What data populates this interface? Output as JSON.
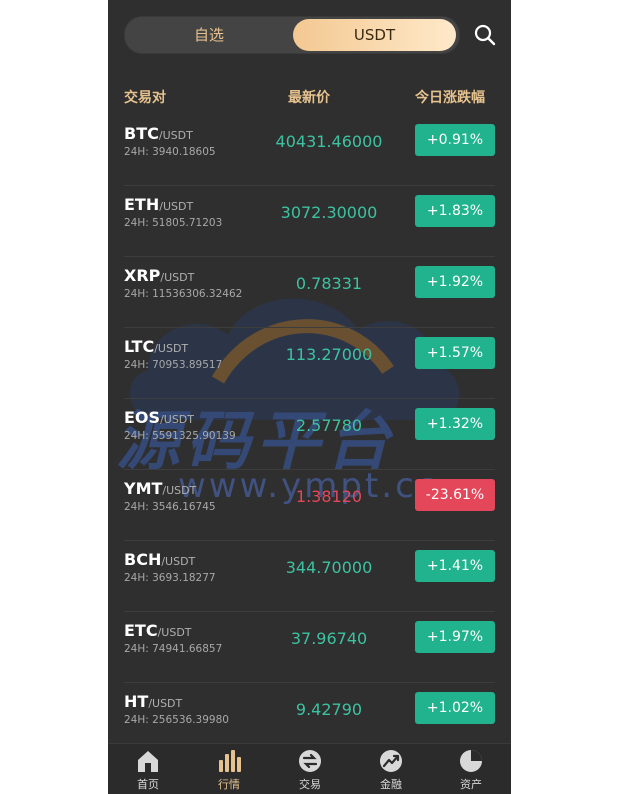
{
  "tabs": {
    "watchlist": "自选",
    "usdt": "USDT"
  },
  "table_header": {
    "pair": "交易对",
    "price": "最新价",
    "change": "今日涨跌幅"
  },
  "rows": [
    {
      "base": "BTC",
      "quote": "/USDT",
      "volume": "24H: 3940.18605",
      "price": "40431.46000",
      "change": "+0.91%",
      "direction": "up"
    },
    {
      "base": "ETH",
      "quote": "/USDT",
      "volume": "24H: 51805.71203",
      "price": "3072.30000",
      "change": "+1.83%",
      "direction": "up"
    },
    {
      "base": "XRP",
      "quote": "/USDT",
      "volume": "24H: 11536306.32462",
      "price": "0.78331",
      "change": "+1.92%",
      "direction": "up"
    },
    {
      "base": "LTC",
      "quote": "/USDT",
      "volume": "24H: 70953.89517",
      "price": "113.27000",
      "change": "+1.57%",
      "direction": "up"
    },
    {
      "base": "EOS",
      "quote": "/USDT",
      "volume": "24H: 5591325.90139",
      "price": "2.57780",
      "change": "+1.32%",
      "direction": "up"
    },
    {
      "base": "YMT",
      "quote": "/USDT",
      "volume": "24H: 3546.16745",
      "price": "1.38120",
      "change": "-23.61%",
      "direction": "down"
    },
    {
      "base": "BCH",
      "quote": "/USDT",
      "volume": "24H: 3693.18277",
      "price": "344.70000",
      "change": "+1.41%",
      "direction": "up"
    },
    {
      "base": "ETC",
      "quote": "/USDT",
      "volume": "24H: 74941.66857",
      "price": "37.96740",
      "change": "+1.97%",
      "direction": "up"
    },
    {
      "base": "HT",
      "quote": "/USDT",
      "volume": "24H: 256536.39980",
      "price": "9.42790",
      "change": "+1.02%",
      "direction": "up"
    }
  ],
  "nav": [
    {
      "label": "首页",
      "icon": "home-icon"
    },
    {
      "label": "行情",
      "icon": "market-bars-icon",
      "active": true
    },
    {
      "label": "交易",
      "icon": "trade-icon"
    },
    {
      "label": "金融",
      "icon": "finance-icon"
    },
    {
      "label": "资产",
      "icon": "assets-pie-icon"
    }
  ],
  "watermark": {
    "text": "源码平台",
    "url": "www.ympt.cc"
  },
  "colors": {
    "accent": "#e6c28e",
    "up": "#21b38d",
    "down": "#e5475a",
    "background": "#2f2f2f"
  }
}
